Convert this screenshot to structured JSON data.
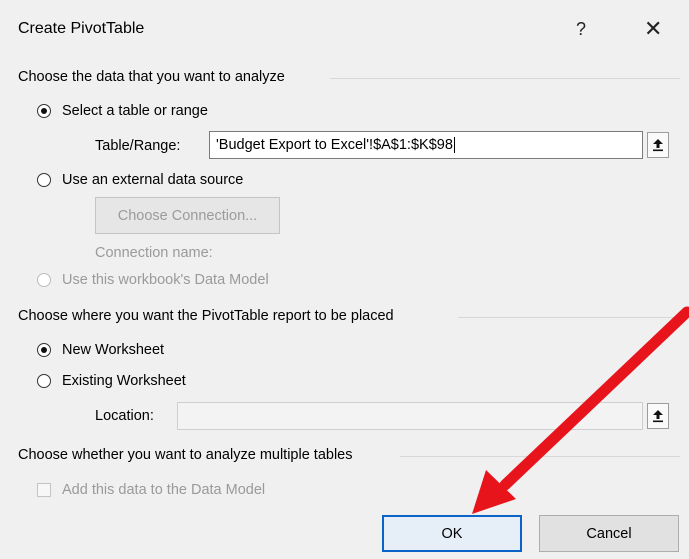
{
  "dialog": {
    "title": "Create PivotTable",
    "help_glyph": "?",
    "close_glyph": "✕"
  },
  "source_section": {
    "header": "Choose the data that you want to analyze",
    "select_range_label": "Select a table or range",
    "table_range_label": "Table/Range:",
    "table_range_value": "'Budget Export to Excel'!$A$1:$K$98",
    "external_source_label": "Use an external data source",
    "choose_connection_label": "Choose Connection...",
    "connection_name_label": "Connection name:",
    "data_model_label": "Use this workbook's Data Model"
  },
  "placement_section": {
    "header": "Choose where you want the PivotTable report to be placed",
    "new_worksheet_label": "New Worksheet",
    "existing_worksheet_label": "Existing Worksheet",
    "location_label": "Location:",
    "location_value": ""
  },
  "multi_section": {
    "header": "Choose whether you want to analyze multiple tables",
    "add_to_model_label": "Add this data to the Data Model"
  },
  "buttons": {
    "ok_label": "OK",
    "cancel_label": "Cancel"
  },
  "colors": {
    "annotation_arrow": "#e8141b",
    "default_button_border": "#0a64c8"
  },
  "icons": {
    "range_picker": "upload-arrow-icon"
  }
}
